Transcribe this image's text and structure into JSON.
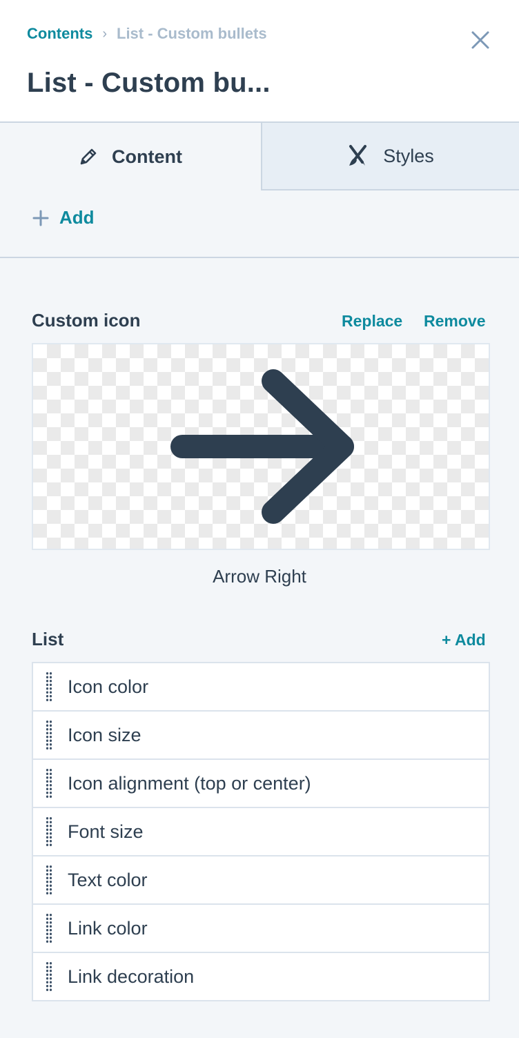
{
  "header": {
    "breadcrumb": {
      "parent": "Contents",
      "separator": "›",
      "current": "List - Custom bullets"
    },
    "title": "List - Custom bu...",
    "close_icon": "close-icon"
  },
  "tabs": [
    {
      "label": "Content",
      "icon": "pencil-icon",
      "active": true
    },
    {
      "label": "Styles",
      "icon": "brush-pen-icon",
      "active": false
    }
  ],
  "add_button": {
    "label": "Add",
    "icon": "plus-icon"
  },
  "custom_icon": {
    "label": "Custom icon",
    "replace_label": "Replace",
    "remove_label": "Remove",
    "icon_name": "Arrow Right",
    "icon_color": "#2e3f50"
  },
  "list": {
    "label": "List",
    "add_label": "+ Add",
    "items": [
      {
        "label": "Icon color"
      },
      {
        "label": "Icon size"
      },
      {
        "label": "Icon alignment (top or center)"
      },
      {
        "label": "Font size"
      },
      {
        "label": "Text color"
      },
      {
        "label": "Link color"
      },
      {
        "label": "Link decoration"
      }
    ]
  },
  "colors": {
    "accent": "#0e8a9e",
    "text": "#2e3f50",
    "muted": "#a9bbcc",
    "border": "#cbd6e2",
    "background": "#f3f6f9"
  }
}
